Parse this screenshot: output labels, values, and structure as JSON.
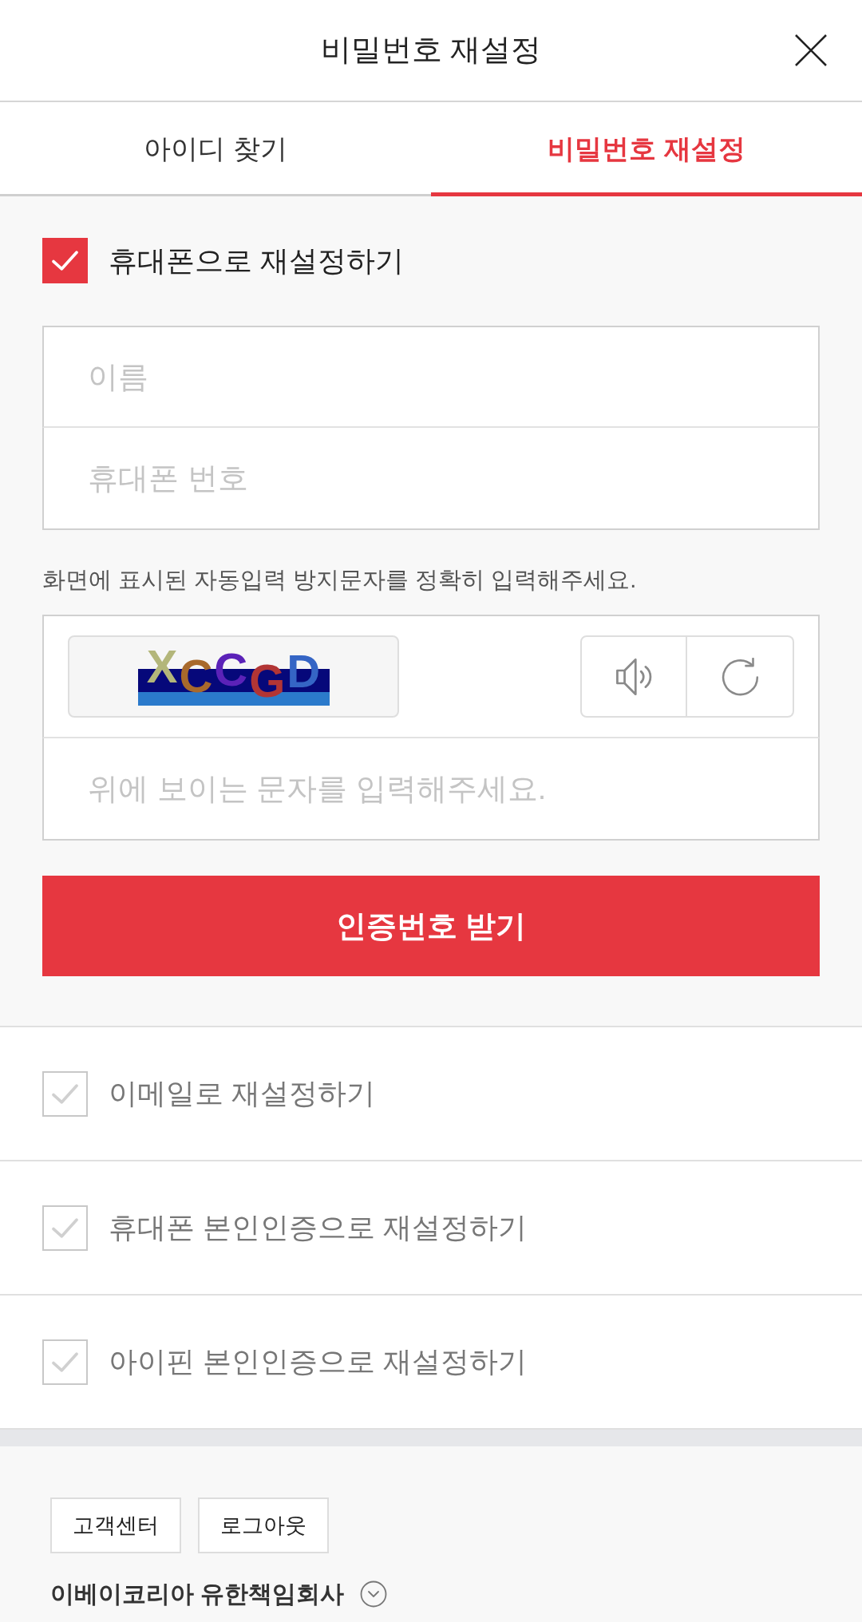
{
  "header": {
    "title": "비밀번호 재설정"
  },
  "tabs": [
    {
      "label": "아이디 찾기",
      "selected": false
    },
    {
      "label": "비밀번호 재설정",
      "selected": true
    }
  ],
  "phone_reset": {
    "label": "휴대폰으로 재설정하기",
    "checked": true,
    "fields": [
      {
        "placeholder": "이름"
      },
      {
        "placeholder": "휴대폰 번호"
      }
    ],
    "captcha_instruction": "화면에 표시된 자동입력 방지문자를 정확히 입력해주세요.",
    "captcha": {
      "letters": [
        {
          "char": "X",
          "color": "#b3b67a"
        },
        {
          "char": "C",
          "color": "#a8692c"
        },
        {
          "char": "C",
          "color": "#5b22b8"
        },
        {
          "char": "G",
          "color": "#b23535"
        },
        {
          "char": "D",
          "color": "#3565c5"
        }
      ],
      "placeholder": "위에 보이는 문자를 입력해주세요."
    },
    "submit_button": "인증번호 받기"
  },
  "other_methods": [
    {
      "label": "이메일로 재설정하기",
      "checked": false
    },
    {
      "label": "휴대폰 본인인증으로 재설정하기",
      "checked": false
    },
    {
      "label": "아이핀 본인인증으로 재설정하기",
      "checked": false
    }
  ],
  "footer": {
    "buttons": [
      "고객센터",
      "로그아웃"
    ],
    "company": "이베이코리아 유한책임회사"
  }
}
